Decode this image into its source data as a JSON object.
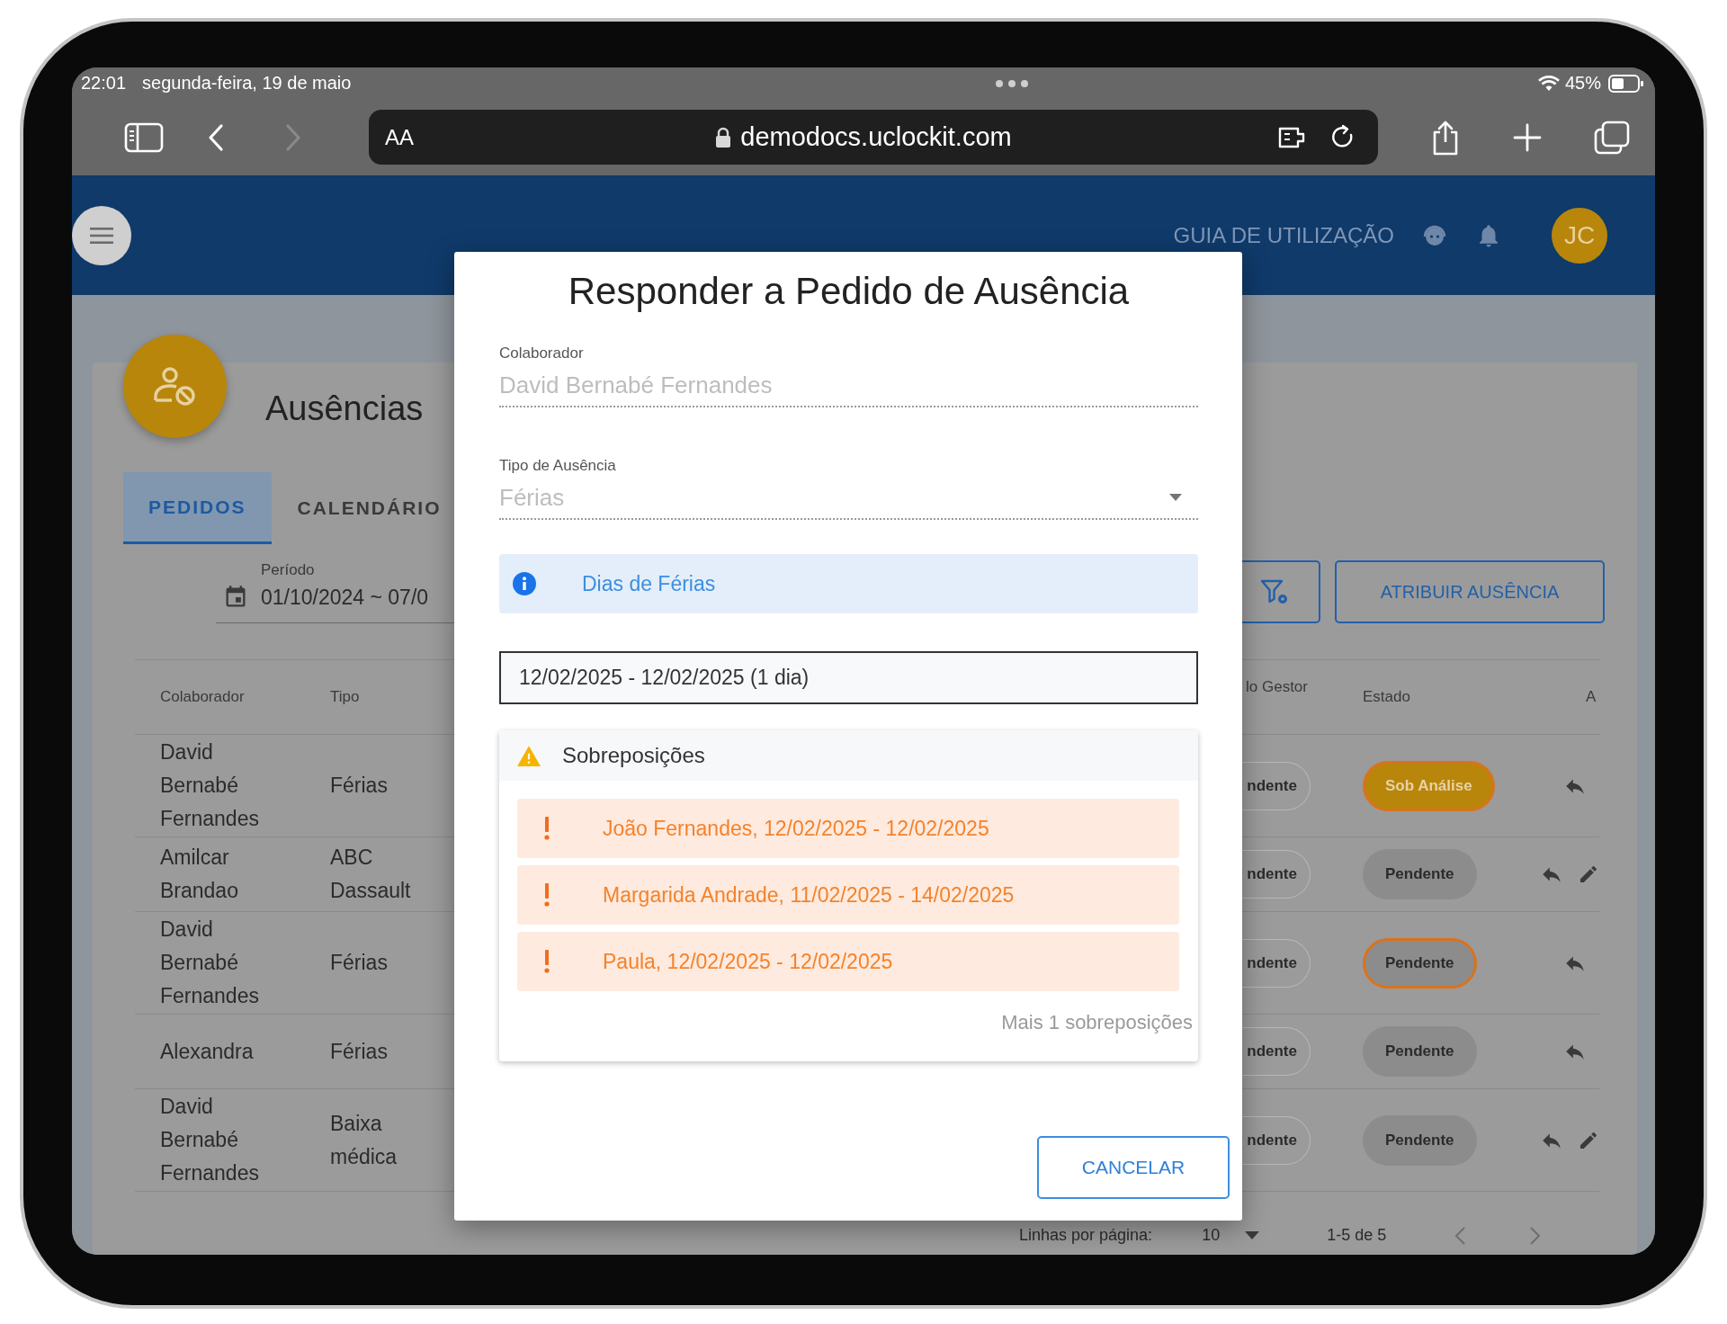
{
  "status_bar": {
    "time": "22:01",
    "date": "segunda-feira, 19 de maio",
    "battery": "45%"
  },
  "browser": {
    "text_size": "AA",
    "url": "demodocs.uclockit.com"
  },
  "header": {
    "guide": "GUIA DE UTILIZAÇÃO",
    "avatar": "JC"
  },
  "page": {
    "title": "Ausências",
    "tabs": [
      {
        "label": "PEDIDOS",
        "selected": true
      },
      {
        "label": "CALENDÁRIO",
        "selected": false
      }
    ],
    "period": {
      "label": "Período",
      "value": "01/10/2024 ~ 07/0"
    },
    "assign_button": "ATRIBUIR AUSÊNCIA"
  },
  "table": {
    "columns": [
      "Colaborador",
      "Tipo",
      "lo Gestor",
      "Estado",
      "A"
    ],
    "rows": [
      {
        "collaborator": "David Bernabé Fernandes",
        "type": "Férias",
        "manager_state": "ndente",
        "state": "Sob Análise",
        "kind": "review",
        "highlighted": true,
        "editable": false
      },
      {
        "collaborator": "Amilcar Brandao",
        "type": "ABC Dassault",
        "manager_state": "ndente",
        "state": "Pendente",
        "kind": "pending",
        "highlighted": false,
        "editable": true
      },
      {
        "collaborator": "David Bernabé Fernandes",
        "type": "Férias",
        "manager_state": "ndente",
        "state": "Pendente",
        "kind": "pending",
        "highlighted": true,
        "editable": false
      },
      {
        "collaborator": "Alexandra",
        "type": "Férias",
        "manager_state": "ndente",
        "state": "Pendente",
        "kind": "pending",
        "highlighted": false,
        "editable": false
      },
      {
        "collaborator": "David Bernabé Fernandes",
        "type": "Baixa médica",
        "manager_state": "ndente",
        "state": "Pendente",
        "kind": "pending",
        "highlighted": false,
        "editable": true
      }
    ]
  },
  "pagination": {
    "label": "Linhas por página:",
    "per_page": "10",
    "range": "1-5 de 5"
  },
  "dialog": {
    "title": "Responder a Pedido de Ausência",
    "fields": [
      {
        "kind": "text",
        "label": "Colaborador",
        "value": "David Bernabé Fernandes",
        "disabled": true
      },
      {
        "kind": "select",
        "label": "Tipo de Ausência",
        "value": "Férias",
        "disabled": true
      }
    ],
    "info": "Dias de Férias",
    "dates": "12/02/2025 - 12/02/2025 (1 dia)",
    "overlaps": {
      "title": "Sobreposições",
      "items": [
        "João Fernandes, 12/02/2025 - 12/02/2025",
        "Margarida Andrade, 11/02/2025 - 14/02/2025",
        "Paula, 12/02/2025 - 12/02/2025"
      ],
      "more": "Mais 1 sobreposições"
    },
    "cancel": "CANCELAR"
  }
}
